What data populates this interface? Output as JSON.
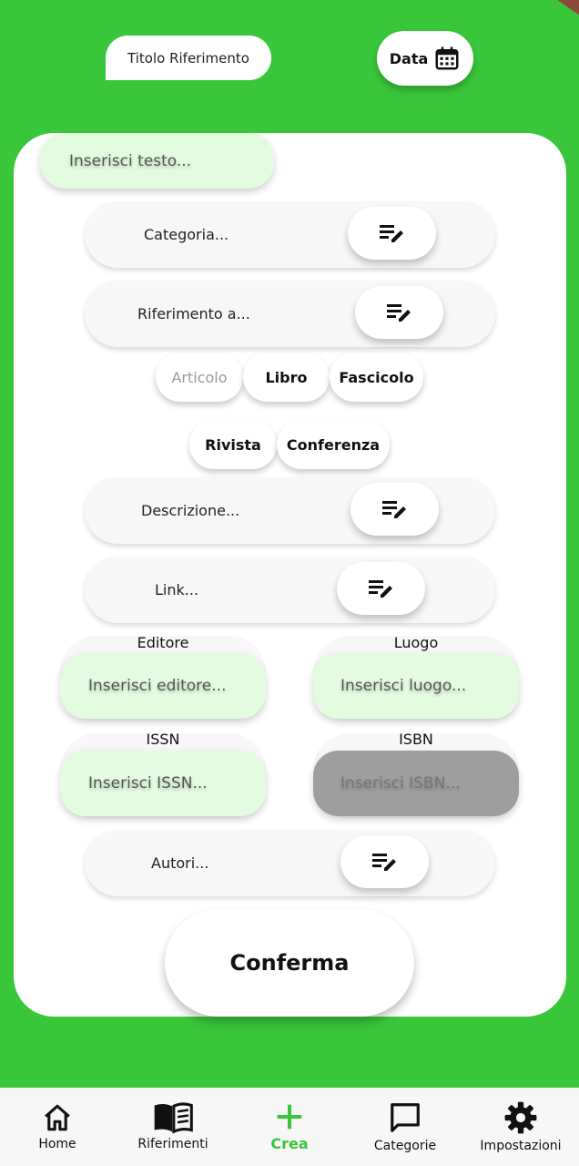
{
  "header": {
    "title_placeholder": "Titolo Riferimento",
    "date_label": "Data"
  },
  "form": {
    "text_placeholder": "Inserisci testo...",
    "category_label": "Categoria...",
    "reference_label": "Riferimento a...",
    "reference_types": [
      "Articolo",
      "Libro",
      "Fascicolo",
      "Rivista",
      "Conferenza"
    ],
    "description_label": "Descrizione...",
    "link_label": "Link...",
    "publisher_label": "Editore",
    "publisher_placeholder": "Inserisci editore...",
    "place_label": "Luogo",
    "place_placeholder": "Inserisci luogo...",
    "issn_label": "ISSN",
    "issn_placeholder": "Inserisci ISSN...",
    "isbn_label": "ISBN",
    "isbn_placeholder": "Inserisci ISBN...",
    "authors_label": "Autori...",
    "confirm_label": "Conferma"
  },
  "nav": {
    "items": [
      {
        "label": "Home",
        "icon": "home-icon"
      },
      {
        "label": "Riferimenti",
        "icon": "book-icon"
      },
      {
        "label": "Crea",
        "icon": "plus-icon"
      },
      {
        "label": "Categorie",
        "icon": "chat-icon"
      },
      {
        "label": "Impostazioni",
        "icon": "gear-icon"
      }
    ],
    "active": "Crea"
  },
  "colors": {
    "background": "#3ac63a",
    "input_bg": "#e3fce0",
    "disabled_input_bg": "#9e9e9e",
    "active_nav": "#3ac63a"
  }
}
